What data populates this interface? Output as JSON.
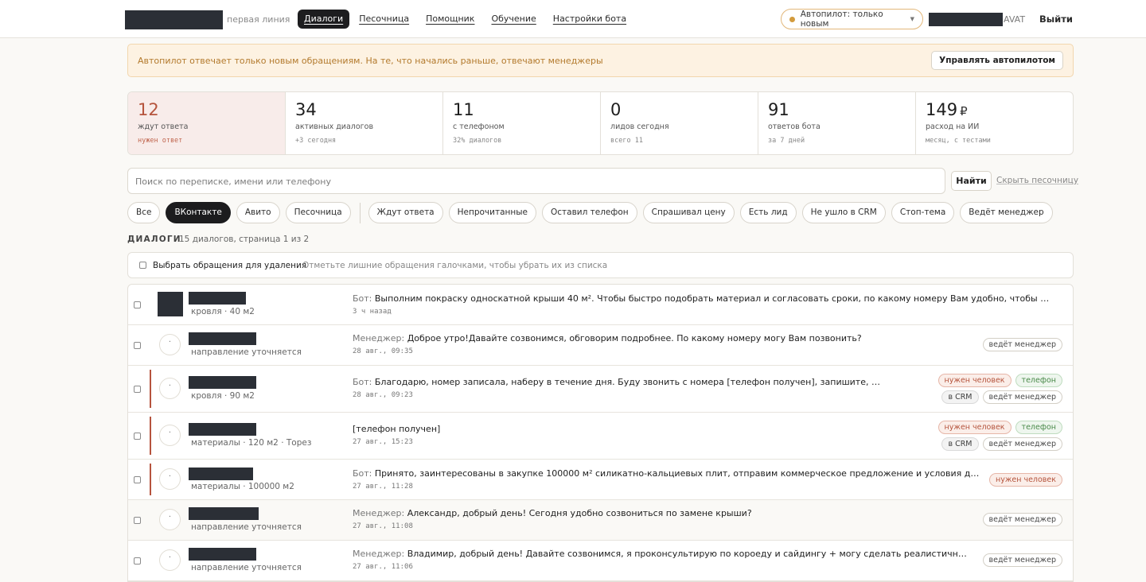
{
  "header": {
    "brand_sub": "первая линия",
    "nav": [
      "Диалоги",
      "Песочница",
      "Помощник",
      "Обучение",
      "Настройки бота"
    ],
    "autopilot_label": "Автопилот: только новым",
    "user_suffix": "AVAT",
    "logout": "Выйти"
  },
  "banner": {
    "text": "Автопилот отвечает только новым обращениям. На те, что начались раньше, отвечают менеджеры",
    "button": "Управлять автопилотом"
  },
  "stats": [
    {
      "num": "12",
      "label": "ждут ответа",
      "sub": "нужен ответ"
    },
    {
      "num": "34",
      "label": "активных диалогов",
      "sub": "+3 сегодня"
    },
    {
      "num": "11",
      "label": "с телефоном",
      "sub": "32% диалогов"
    },
    {
      "num": "0",
      "label": "лидов сегодня",
      "sub": "всего 11"
    },
    {
      "num": "91",
      "label": "ответов бота",
      "sub": "за 7 дней"
    },
    {
      "num": "149",
      "currency": "₽",
      "label": "расход на ИИ",
      "sub": "месяц, с тестами"
    }
  ],
  "search": {
    "placeholder": "Поиск по переписке, имени или телефону",
    "button": "Найти",
    "hide_sandbox": "Скрыть песочницу"
  },
  "filters": {
    "sources": [
      "Все",
      "ВКонтакте",
      "Авито",
      "Песочница"
    ],
    "status": [
      "Ждут ответа",
      "Непрочитанные",
      "Оставил телефон",
      "Спрашивал цену",
      "Есть лид",
      "Не ушло в CRM",
      "Стоп-тема",
      "Ведёт менеджер"
    ]
  },
  "section": {
    "title": "ДИАЛОГИ",
    "meta": "15 диалогов, страница 1 из 2"
  },
  "select_bar": {
    "label": "Выбрать обращения для удаления",
    "hint": "Отметьте лишние обращения галочками, чтобы убрать их из списка"
  },
  "dialogs": [
    {
      "topic": "кровля · 40 м2",
      "who": "Бот:",
      "text": "Выполним покраску односкатной крыши 40 м². Чтобы быстро подобрать материал и согласовать сроки, по какому номеру Вам удобно, чтобы я позво...",
      "time": "3 ч назад",
      "tags": []
    },
    {
      "topic": "направление уточняется",
      "who": "Менеджер:",
      "text": "Доброе утро!Давайте созвонимся, обговорим подробнее. По какому номеру могу Вам позвонить?",
      "time": "28 авг., 09:35",
      "tags": [
        "ведёт менеджер"
      ]
    },
    {
      "topic": "кровля · 90 м2",
      "who": "Бот:",
      "text": "Благодарю, номер записала, наберу в течение дня. Буду звонить с номера [телефон получен], запишите, пожалу...",
      "time": "28 авг., 09:23",
      "tags": [
        "нужен человек",
        "телефон",
        "в CRM",
        "ведёт менеджер"
      ]
    },
    {
      "topic": "материалы · 120 м2 · Торез",
      "who": "",
      "text": "[телефон получен]",
      "time": "27 авг., 15:23",
      "tags": [
        "нужен человек",
        "телефон",
        "в CRM",
        "ведёт менеджер"
      ]
    },
    {
      "topic": "материалы · 100000 м2",
      "who": "Бот:",
      "text": "Принято, заинтересованы в закупке 100000 м² силикатно-кальциевых плит, отправим коммерческое предложение и условия доставки...",
      "time": "27 авг., 11:28",
      "tags": [
        "нужен человек"
      ]
    },
    {
      "topic": "направление уточняется",
      "who": "Менеджер:",
      "text": "Александр, добрый день! Сегодня удобно созвониться по замене крыши?",
      "time": "27 авг., 11:08",
      "tags": [
        "ведёт менеджер"
      ]
    },
    {
      "topic": "направление уточняется",
      "who": "Менеджер:",
      "text": "Владимир, добрый день! Давайте созвонимся, я проконсультирую по короеду и сайдингу + могу сделать реалистичные визуа...",
      "time": "27 авг., 11:06",
      "tags": [
        "ведёт менеджер"
      ]
    }
  ],
  "colors": {
    "accent": "#b5543d",
    "dark": "#1d1d1f",
    "banner_bg": "#fdf2e2"
  }
}
